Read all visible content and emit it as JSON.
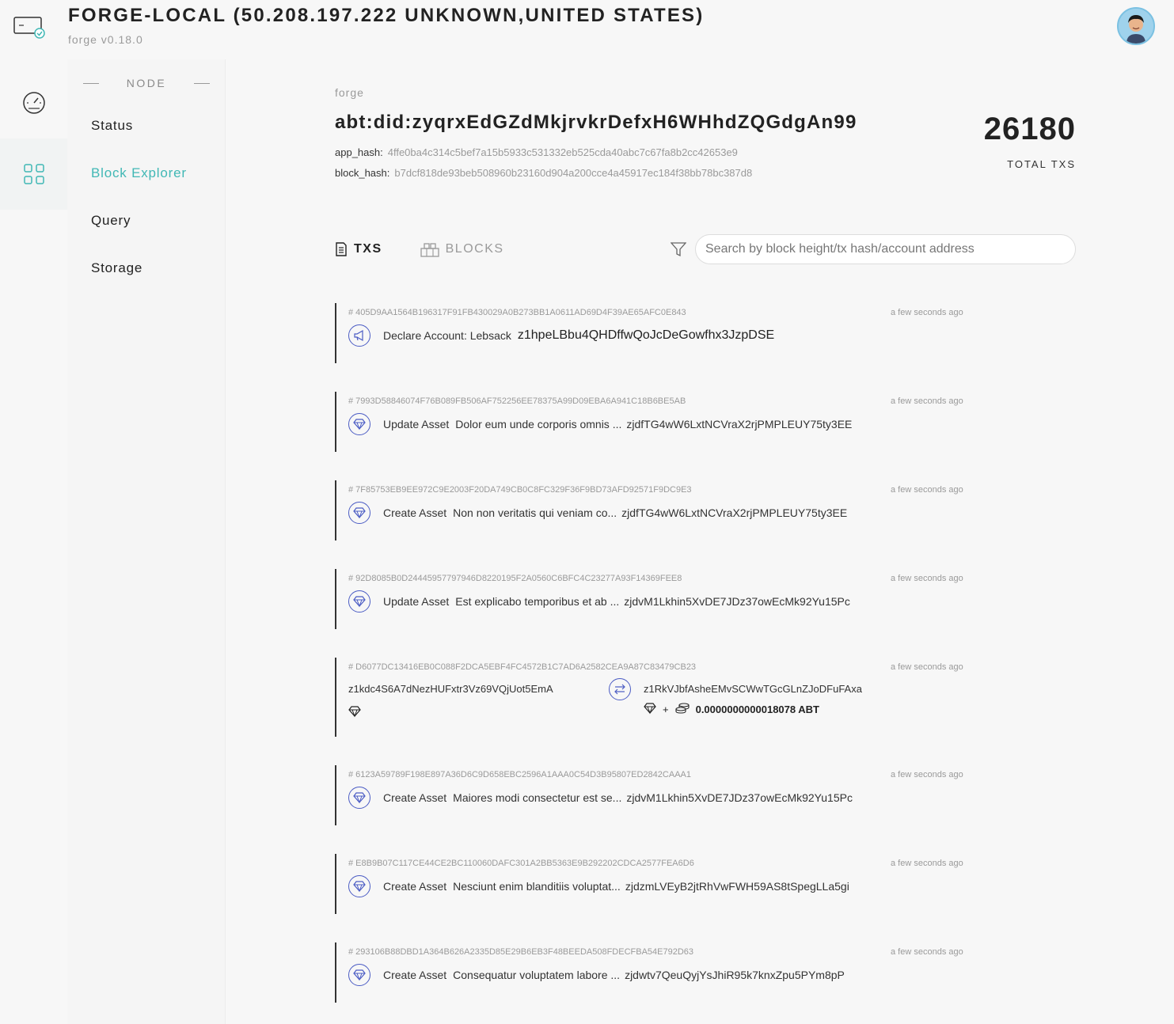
{
  "header": {
    "title": "FORGE-LOCAL (50.208.197.222 UNKNOWN,UNITED STATES)",
    "subtitle": "forge v0.18.0"
  },
  "rail": {
    "items": [
      {
        "icon": "speedometer-icon"
      },
      {
        "icon": "grid-icon"
      }
    ]
  },
  "sidebar": {
    "section": "NODE",
    "items": [
      {
        "label": "Status"
      },
      {
        "label": "Block Explorer"
      },
      {
        "label": "Query"
      },
      {
        "label": "Storage"
      }
    ]
  },
  "chain": {
    "label": "forge",
    "did": "abt:did:zyqrxEdGZdMkjrvkrDefxH6WHhdZQGdgAn99",
    "app_hash_label": "app_hash:",
    "app_hash": "4ffe0ba4c314c5bef7a15b5933c531332eb525cda40abc7c67fa8b2cc42653e9",
    "block_hash_label": "block_hash:",
    "block_hash": "b7dcf818de93beb508960b23160d904a200cce4a45917ec184f38bb78bc387d8",
    "total_txs": "26180",
    "total_txs_label": "TOTAL TXS"
  },
  "tabs": {
    "txs": "TXS",
    "blocks": "BLOCKS"
  },
  "search": {
    "placeholder": "Search by block height/tx hash/account address"
  },
  "accent_color": "#41b8b5",
  "icon_color": "#4b5cc4",
  "txs": [
    {
      "hash": "# 405D9AA1564B196317F91FB430029A0B273BB1A0611AD69D4F39AE65AFC0E843",
      "time": "a few seconds ago",
      "icon": "megaphone-icon",
      "type": "Declare Account: Lebsack",
      "name": "",
      "addr": "z1hpeLBbu4QHDffwQoJcDeGowfhx3JzpDSE"
    },
    {
      "hash": "# 7993D58846074F76B089FB506AF752256EE78375A99D09EBA6A941C18B6BE5AB",
      "time": "a few seconds ago",
      "icon": "diamond-icon",
      "type": "Update Asset",
      "name": "Dolor eum unde corporis omnis ...",
      "addr": "zjdfTG4wW6LxtNCVraX2rjPMPLEUY75ty3EE"
    },
    {
      "hash": "# 7F85753EB9EE972C9E2003F20DA749CB0C8FC329F36F9BD73AFD92571F9DC9E3",
      "time": "a few seconds ago",
      "icon": "diamond-icon",
      "type": "Create Asset",
      "name": "Non non veritatis qui veniam co...",
      "addr": "zjdfTG4wW6LxtNCVraX2rjPMPLEUY75ty3EE"
    },
    {
      "hash": "# 92D8085B0D24445957797946D8220195F2A0560C6BFC4C23277A93F14369FEE8",
      "time": "a few seconds ago",
      "icon": "diamond-icon",
      "type": "Update Asset",
      "name": "Est explicabo temporibus et ab ...",
      "addr": "zjdvM1Lkhin5XvDE7JDz37owEcMk92Yu15Pc"
    },
    {
      "hash": "# D6077DC13416EB0C088F2DCA5EBF4FC4572B1C7AD6A2582CEA9A87C83479CB23",
      "time": "a few seconds ago",
      "transfer": true,
      "from": "z1kdc4S6A7dNezHUFxtr3Vz69VQjUot5EmA",
      "to": "z1RkVJbfAsheEMvSCWwTGcGLnZJoDFuFAxa",
      "plus": "+",
      "amount": "0.0000000000018078 ABT"
    },
    {
      "hash": "# 6123A59789F198E897A36D6C9D658EBC2596A1AAA0C54D3B95807ED2842CAAA1",
      "time": "a few seconds ago",
      "icon": "diamond-icon",
      "type": "Create Asset",
      "name": "Maiores modi consectetur est se...",
      "addr": "zjdvM1Lkhin5XvDE7JDz37owEcMk92Yu15Pc"
    },
    {
      "hash": "# E8B9B07C117CE44CE2BC110060DAFC301A2BB5363E9B292202CDCA2577FEA6D6",
      "time": "a few seconds ago",
      "icon": "diamond-icon",
      "type": "Create Asset",
      "name": "Nesciunt enim blanditiis voluptat...",
      "addr": "zjdzmLVEyB2jtRhVwFWH59AS8tSpegLLa5gi"
    },
    {
      "hash": "# 293106B88DBD1A364B626A2335D85E29B6EB3F48BEEDA508FDECFBA54E792D63",
      "time": "a few seconds ago",
      "icon": "diamond-icon",
      "type": "Create Asset",
      "name": "Consequatur voluptatem labore ...",
      "addr": "zjdwtv7QeuQyjYsJhiR95k7knxZpu5PYm8pP"
    }
  ]
}
